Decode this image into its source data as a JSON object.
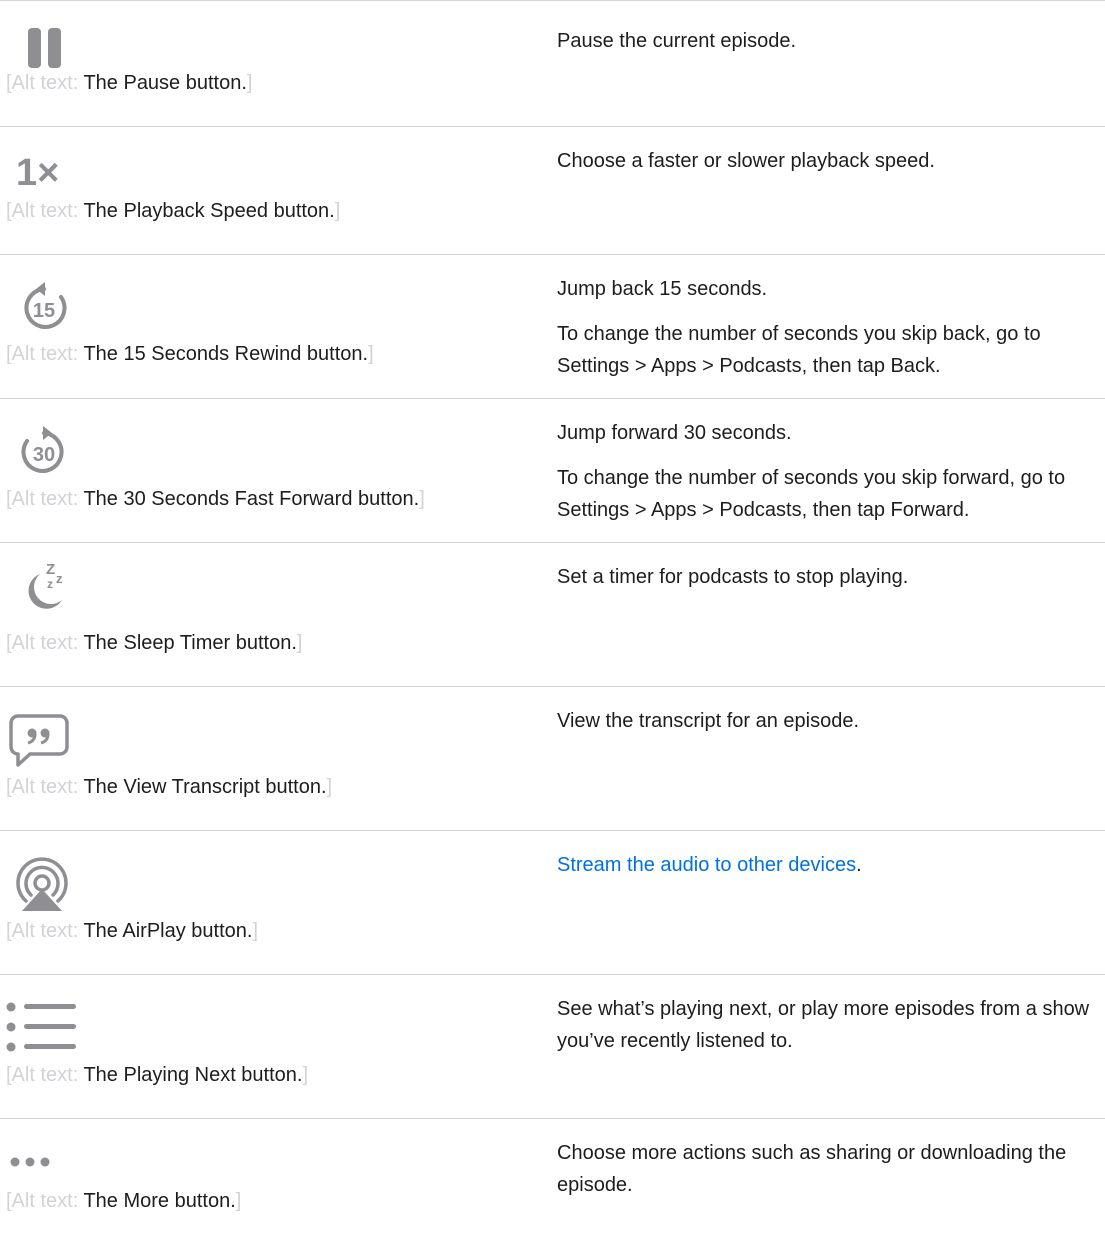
{
  "alt_prefix": "[Alt text: ",
  "alt_suffix": "]",
  "rows": [
    {
      "icon": "pause-icon",
      "alt": "The Pause button.",
      "desc": [
        "Pause the current episode."
      ]
    },
    {
      "icon": "playback-speed-icon",
      "icon_text": "1×",
      "alt": "The Playback Speed button.",
      "desc": [
        "Choose a faster or slower playback speed."
      ]
    },
    {
      "icon": "rewind-15-icon",
      "icon_text": "15",
      "alt": "The 15 Seconds Rewind button.",
      "desc": [
        "Jump back 15 seconds.",
        "To change the number of seconds you skip back, go to Settings > Apps > Podcasts, then tap Back."
      ]
    },
    {
      "icon": "forward-30-icon",
      "icon_text": "30",
      "alt": "The 30 Seconds Fast Forward button.",
      "desc": [
        "Jump forward 30 seconds.",
        "To change the number of seconds you skip forward, go to Settings > Apps > Podcasts, then tap Forward."
      ]
    },
    {
      "icon": "sleep-timer-icon",
      "alt": "The Sleep Timer button.",
      "desc": [
        "Set a timer for podcasts to stop playing."
      ]
    },
    {
      "icon": "transcript-icon",
      "alt": "The View Transcript button.",
      "desc": [
        "View the transcript for an episode."
      ]
    },
    {
      "icon": "airplay-icon",
      "alt": "The AirPlay button.",
      "desc_link": "Stream the audio to other devices",
      "desc_after_link": "."
    },
    {
      "icon": "playing-next-icon",
      "alt": "The Playing Next button.",
      "desc": [
        "See what’s playing next, or play more episodes from a show you’ve recently listened to."
      ]
    },
    {
      "icon": "more-icon",
      "alt": "The More button.",
      "desc": [
        "Choose more actions such as sharing or downloading the episode."
      ]
    }
  ],
  "colors": {
    "icon_gray": "#8e8e93",
    "link_blue": "#0071e3",
    "divider": "#d2d2d7",
    "bracket_gray": "#d2d2d7"
  }
}
